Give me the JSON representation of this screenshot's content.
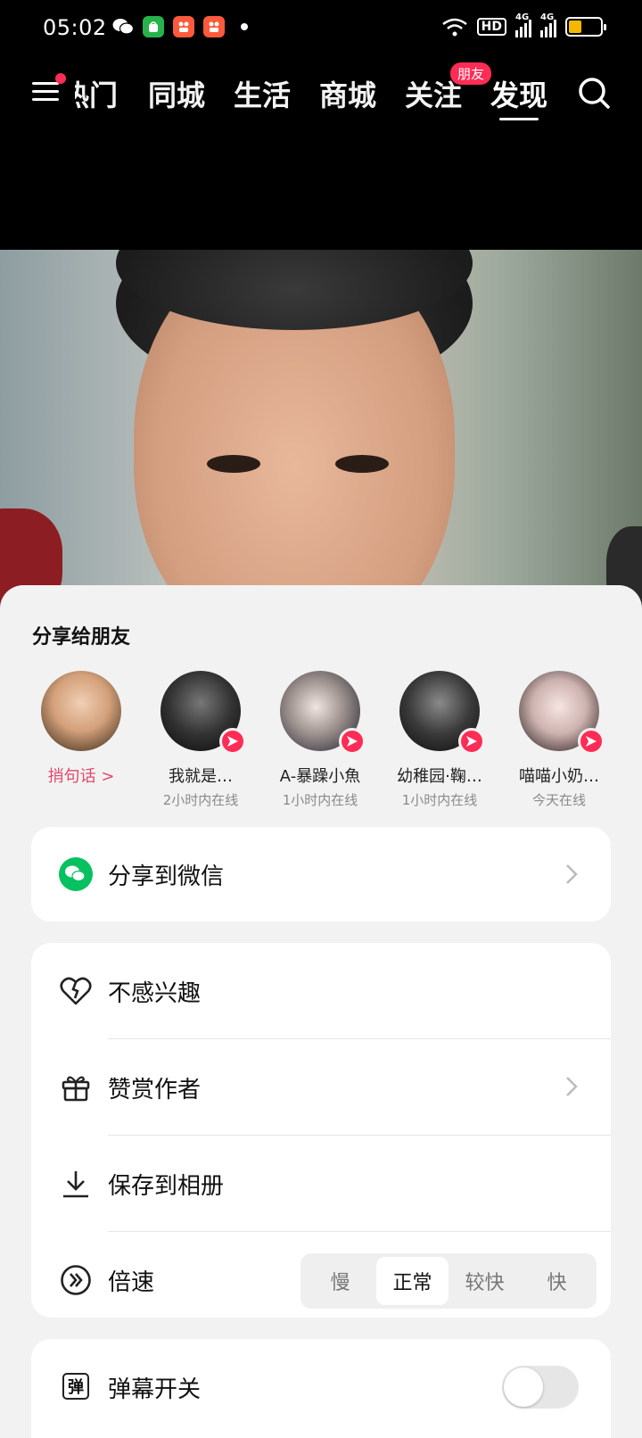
{
  "status_bar": {
    "time": "05:02",
    "hd_label": "HD",
    "net1": "4G",
    "net2": "4G"
  },
  "nav": {
    "tabs": [
      "热门",
      "同城",
      "生活",
      "商城",
      "关注",
      "发现"
    ],
    "active_tab": "发现",
    "follow_badge": "朋友"
  },
  "sheet": {
    "title": "分享给朋友",
    "friends": [
      {
        "name": "捎句话 >",
        "status": ""
      },
      {
        "name": "我就是…",
        "status": "2小时内在线"
      },
      {
        "name": "A-暴躁小魚",
        "status": "1小时内在线"
      },
      {
        "name": "幼稚园·鞠…",
        "status": "1小时内在线"
      },
      {
        "name": "喵喵小奶…",
        "status": "今天在线"
      }
    ],
    "wechat_label": "分享到微信",
    "options": {
      "not_interested": "不感兴趣",
      "reward_author": "赞赏作者",
      "save_album": "保存到相册",
      "speed": "倍速"
    },
    "speed_options": [
      "慢",
      "正常",
      "较快",
      "快"
    ],
    "speed_selected": "正常",
    "danmaku_label": "弹幕开关",
    "danmaku_icon_text": "弹",
    "danmaku_enabled": false
  },
  "colors": {
    "accent": "#ff2c55",
    "wechat_green": "#07c160"
  }
}
